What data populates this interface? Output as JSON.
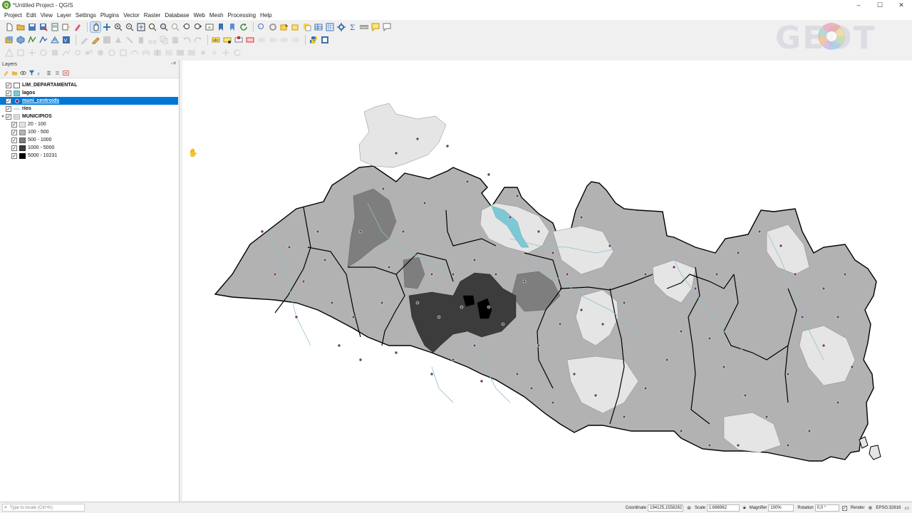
{
  "window": {
    "title": "*Untitled Project - QGIS",
    "minimize": "–",
    "maximize": "☐",
    "close": "✕"
  },
  "menu": [
    "Project",
    "Edit",
    "View",
    "Layer",
    "Settings",
    "Plugins",
    "Vector",
    "Raster",
    "Database",
    "Web",
    "Mesh",
    "Processing",
    "Help"
  ],
  "watermark": {
    "text": "GEOT"
  },
  "layers_panel": {
    "title": "Layers",
    "header_buttons": "▫✕",
    "layers": [
      {
        "label": "LIM_DEPARTAMENTAL",
        "checked": true,
        "symbol": "#ffffff",
        "expander": "",
        "indent": 0,
        "selected": false
      },
      {
        "label": "lagos",
        "checked": true,
        "symbol": "#7ec8d6",
        "expander": "",
        "indent": 0,
        "selected": false
      },
      {
        "label": "muni_centroids",
        "checked": true,
        "symbol": "point",
        "expander": "",
        "indent": 0,
        "selected": true
      },
      {
        "label": "rios",
        "checked": true,
        "symbol": "line",
        "expander": "",
        "indent": 0,
        "selected": false
      },
      {
        "label": "MUNICIPIOS",
        "checked": true,
        "symbol": "folder",
        "expander": "▾",
        "indent": 0,
        "selected": false
      }
    ],
    "classes": [
      {
        "label": "20 - 100",
        "checked": true,
        "color": "#e5e5e5"
      },
      {
        "label": "100 - 500",
        "checked": true,
        "color": "#b2b2b2"
      },
      {
        "label": "500 - 1000",
        "checked": true,
        "color": "#7e7e7e"
      },
      {
        "label": "1000 - 5000",
        "checked": true,
        "color": "#3c3c3c"
      },
      {
        "label": "5000 - 10231",
        "checked": true,
        "color": "#000000"
      }
    ]
  },
  "statusbar": {
    "locate_placeholder": "Type to locate (Ctrl+K)",
    "coordinate_label": "Coordinate",
    "coordinate_value": "194125,1558282",
    "scale_label": "Scale",
    "scale_value": "1:666962",
    "magnifier_label": "Magnifier",
    "magnifier_value": "100%",
    "rotation_label": "Rotation",
    "rotation_value": "0,0 °",
    "render_label": "Render",
    "crs_label": "EPSG:32616"
  },
  "colors": {
    "accent": "#0078d7",
    "class_20_100": "#e5e5e5",
    "class_100_500": "#b2b2b2",
    "class_500_1000": "#7e7e7e",
    "class_1000_5000": "#3c3c3c",
    "class_5000_10231": "#000000",
    "centroid": "#6b3d6b",
    "lake": "#7ec8d6",
    "river": "#8fbfcc"
  }
}
